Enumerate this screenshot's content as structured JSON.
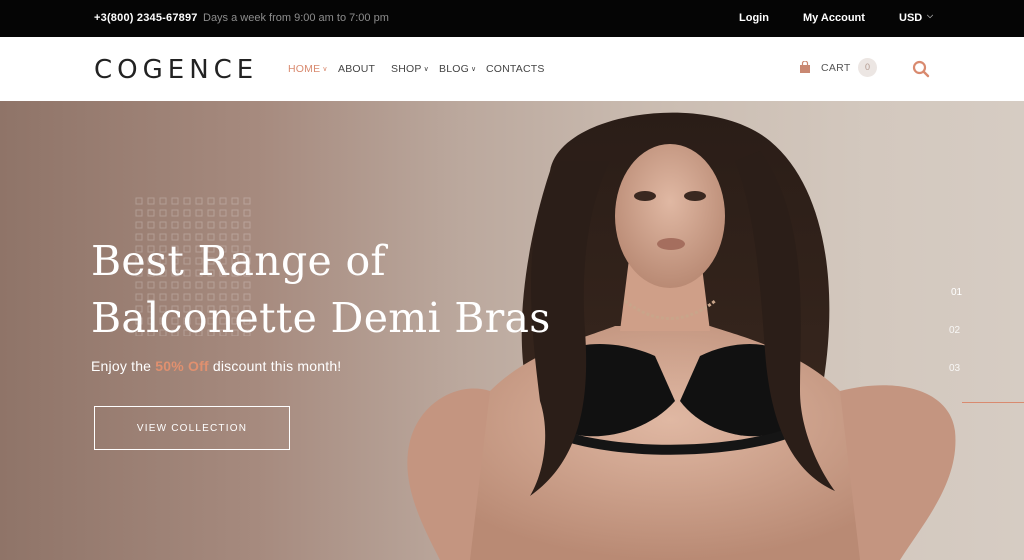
{
  "topbar": {
    "phone": "+3(800) 2345-67897",
    "hours": "Days a week from 9:00 am to 7:00 pm",
    "login": "Login",
    "my_account": "My Account",
    "currency": "USD"
  },
  "header": {
    "logo": "COGENCE",
    "nav": [
      {
        "label": "HOME",
        "active": true,
        "has_dropdown": true
      },
      {
        "label": "ABOUT",
        "active": false,
        "has_dropdown": false
      },
      {
        "label": "SHOP",
        "active": false,
        "has_dropdown": true
      },
      {
        "label": "BLOG",
        "active": false,
        "has_dropdown": true
      },
      {
        "label": "CONTACTS",
        "active": false,
        "has_dropdown": false
      }
    ],
    "cart_label": "CART",
    "cart_count": "0"
  },
  "hero": {
    "title_line1": "Best Range of",
    "title_line2": "Balconette Demi Bras",
    "sub_prefix": "Enjoy the ",
    "sub_accent": "50% Off",
    "sub_suffix": " discount this month!",
    "button": "VIEW COLLECTION",
    "slides": [
      "01",
      "02",
      "03"
    ]
  },
  "colors": {
    "accent": "#d98a6f",
    "topbar_bg": "#050505"
  },
  "icons": {
    "cart": "shopping-bag-icon",
    "search": "search-icon",
    "dropdown": "chevron-down-icon"
  }
}
